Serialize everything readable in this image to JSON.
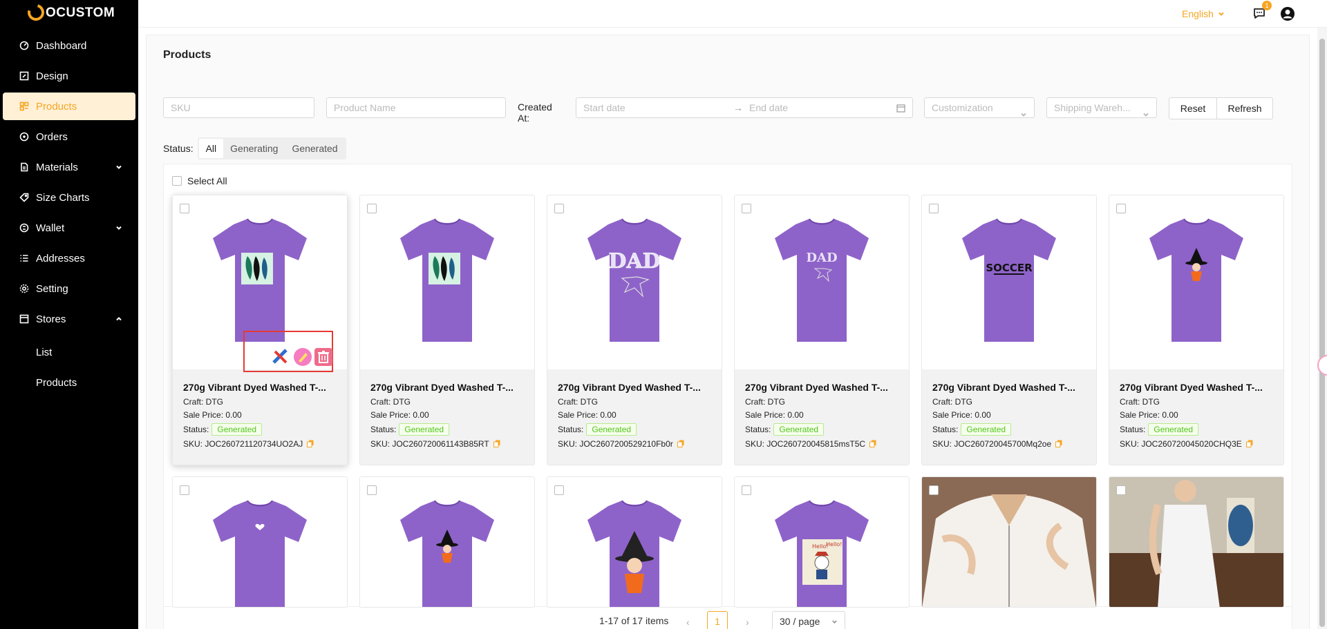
{
  "app": {
    "logo_text": "OCUSTOM"
  },
  "sidebar": {
    "items": [
      {
        "label": "Dashboard",
        "icon": "dashboard-icon"
      },
      {
        "label": "Design",
        "icon": "design-icon"
      },
      {
        "label": "Products",
        "icon": "products-icon",
        "active": true
      },
      {
        "label": "Orders",
        "icon": "orders-icon"
      },
      {
        "label": "Materials",
        "icon": "materials-icon",
        "expandable": true
      },
      {
        "label": "Size Charts",
        "icon": "tag-icon"
      },
      {
        "label": "Wallet",
        "icon": "wallet-icon",
        "expandable": true
      },
      {
        "label": "Addresses",
        "icon": "list-icon"
      },
      {
        "label": "Setting",
        "icon": "gear-icon"
      },
      {
        "label": "Stores",
        "icon": "stores-icon",
        "expanded": true
      }
    ],
    "sub_items": [
      {
        "label": "List"
      },
      {
        "label": "Products"
      }
    ]
  },
  "topbar": {
    "language": "English",
    "notification_count": "1"
  },
  "page": {
    "title": "Products"
  },
  "filters": {
    "sku_placeholder": "SKU",
    "product_name_placeholder": "Product Name",
    "created_at_label": "Created At:",
    "start_date_placeholder": "Start date",
    "end_date_placeholder": "End date",
    "customization_placeholder": "Customization",
    "warehouse_placeholder": "Shipping Wareh...",
    "reset_label": "Reset",
    "refresh_label": "Refresh"
  },
  "status_filter": {
    "label": "Status:",
    "options": [
      "All",
      "Generating",
      "Generated"
    ],
    "selected": "All"
  },
  "grid": {
    "select_all_label": "Select All",
    "products": [
      {
        "title": "270g Vibrant Dyed Washed T-...",
        "craft": "Craft: DTG",
        "price": "Sale Price: 0.00",
        "status_label": "Status:",
        "status": "Generated",
        "sku": "SKU: JOC260721120734UO2AJ",
        "design": "feathers"
      },
      {
        "title": "270g Vibrant Dyed Washed T-...",
        "craft": "Craft: DTG",
        "price": "Sale Price: 0.00",
        "status_label": "Status:",
        "status": "Generated",
        "sku": "SKU: JOC260720061143B85RT",
        "design": "feathers"
      },
      {
        "title": "270g Vibrant Dyed Washed T-...",
        "craft": "Craft: DTG",
        "price": "Sale Price: 0.00",
        "status_label": "Status:",
        "status": "Generated",
        "sku": "SKU: JOC2607200529210Fb0r",
        "design": "dad"
      },
      {
        "title": "270g Vibrant Dyed Washed T-...",
        "craft": "Craft: DTG",
        "price": "Sale Price: 0.00",
        "status_label": "Status:",
        "status": "Generated",
        "sku": "SKU: JOC260720045815msT5C",
        "design": "dad-small"
      },
      {
        "title": "270g Vibrant Dyed Washed T-...",
        "craft": "Craft: DTG",
        "price": "Sale Price: 0.00",
        "status_label": "Status:",
        "status": "Generated",
        "sku": "SKU: JOC260720045700Mq2oe",
        "design": "soccer"
      },
      {
        "title": "270g Vibrant Dyed Washed T-...",
        "craft": "Craft: DTG",
        "price": "Sale Price: 0.00",
        "status_label": "Status:",
        "status": "Generated",
        "sku": "SKU: JOC260720045020CHQ3E",
        "design": "witch-small"
      }
    ],
    "products_row2": [
      {
        "design": "heart"
      },
      {
        "design": "witch-small"
      },
      {
        "design": "witch-large"
      },
      {
        "design": "dog"
      },
      {
        "design": "polo"
      },
      {
        "design": "dress"
      }
    ]
  },
  "design_labels": {
    "dad": "DAD",
    "soccer": "SOCCER",
    "hello": "Hello!"
  },
  "pagination": {
    "total": "1-17 of 17 items",
    "current_page": "1",
    "page_size": "30 / page"
  },
  "colors": {
    "accent": "#f5a623",
    "shirt": "#8e63c9",
    "generated_tag": "#52c41a",
    "highlight_box": "#e53935"
  }
}
